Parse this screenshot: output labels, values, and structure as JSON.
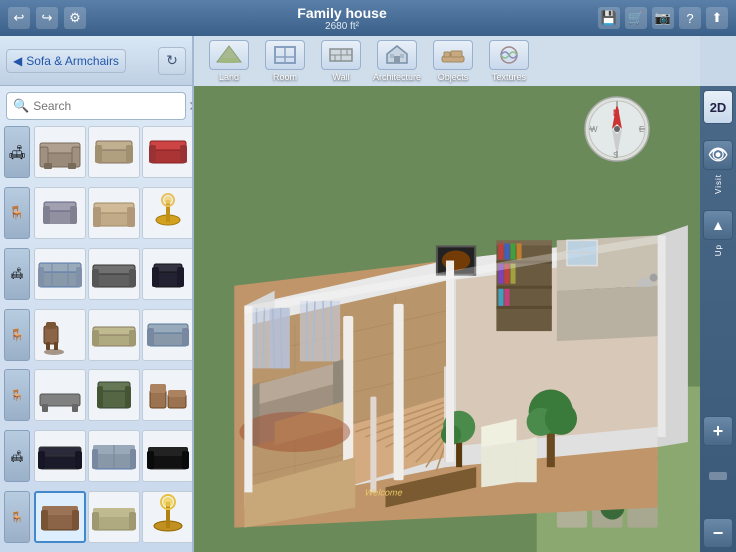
{
  "app": {
    "title": "Family house",
    "subtitle": "2680 ft²"
  },
  "toolbar": {
    "back_label": "Sofa & Armchairs",
    "search_placeholder": "Search",
    "tools": [
      {
        "id": "land",
        "label": "Land",
        "icon": "🏔"
      },
      {
        "id": "room",
        "label": "Room",
        "icon": "⬜"
      },
      {
        "id": "wall",
        "label": "Wall",
        "icon": "🧱"
      },
      {
        "id": "architecture",
        "label": "Architecture",
        "icon": "🏛"
      },
      {
        "id": "objects",
        "label": "Objects",
        "icon": "🛋"
      },
      {
        "id": "textures",
        "label": "Textures",
        "icon": "🎨"
      }
    ]
  },
  "top_icons": {
    "undo": "↩",
    "redo": "↪",
    "settings": "⚙",
    "save": "💾",
    "cart": "🛒",
    "camera": "📷",
    "help": "?",
    "share": "⬆"
  },
  "right_panel": {
    "view_2d": "2D",
    "visit_label": "Visit",
    "up_label": "Up"
  },
  "furniture_items": [
    {
      "id": 1,
      "icon": "🛋",
      "color": "#8899aa",
      "type": "sofa"
    },
    {
      "id": 2,
      "color": "#9a8870",
      "type": "sofa-sm"
    },
    {
      "id": 3,
      "color": "#cc4444",
      "type": "sofa-sm"
    },
    {
      "id": 4,
      "color": "#888",
      "type": "chair"
    },
    {
      "id": 5,
      "color": "#9a8870",
      "type": "sofa"
    },
    {
      "id": 6,
      "color": "#cc9933",
      "type": "lamp"
    },
    {
      "id": 7,
      "color": "#8899aa",
      "type": "sofa"
    },
    {
      "id": 8,
      "color": "#666",
      "type": "sofa-lg"
    },
    {
      "id": 9,
      "color": "#334",
      "type": "chair"
    },
    {
      "id": 10,
      "icon": "🪑",
      "color": "#8B6347"
    },
    {
      "id": 11,
      "color": "#9a8870",
      "type": "sofa"
    },
    {
      "id": 12,
      "color": "#8899aa"
    },
    {
      "id": 13,
      "color": "#888"
    },
    {
      "id": 14,
      "color": "#556644",
      "type": "chair"
    },
    {
      "id": 15,
      "color": "#8B6347"
    },
    {
      "id": 16,
      "color": "#334"
    },
    {
      "id": 17,
      "color": "#8899aa"
    },
    {
      "id": 18,
      "color": "#222"
    },
    {
      "id": 19,
      "icon": "🪑",
      "color": "#8B6347"
    },
    {
      "id": 20,
      "color": "#9a8870"
    },
    {
      "id": 21,
      "color": "#cc9933"
    },
    {
      "id": 22,
      "color": "#9a8870"
    },
    {
      "id": 23,
      "color": "#888"
    },
    {
      "id": 24,
      "color": "#334"
    }
  ]
}
